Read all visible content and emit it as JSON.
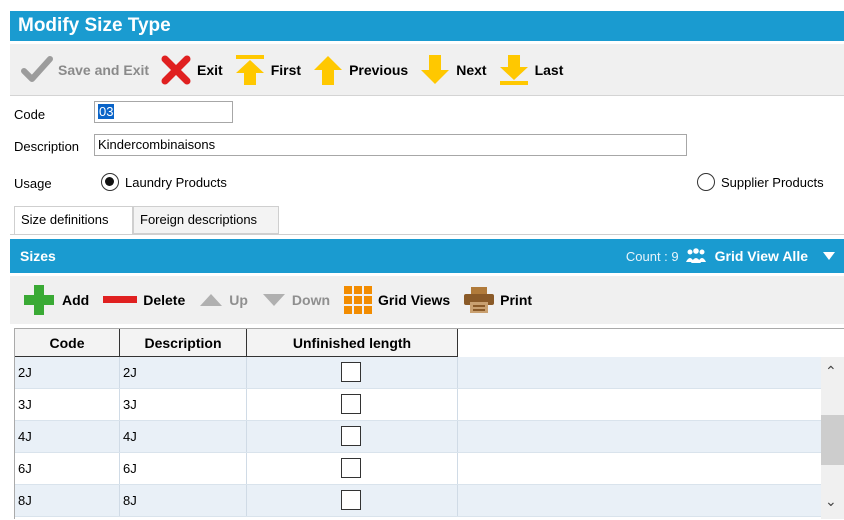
{
  "window": {
    "title": "Modify Size Type"
  },
  "toolbar": {
    "save_exit": "Save and Exit",
    "exit": "Exit",
    "first": "First",
    "previous": "Previous",
    "next": "Next",
    "last": "Last"
  },
  "form": {
    "code_label": "Code",
    "code_value": "03",
    "description_label": "Description",
    "description_value": "Kindercombinaisons",
    "usage_label": "Usage",
    "usage_options": [
      {
        "label": "Laundry Products",
        "selected": true
      },
      {
        "label": "Supplier Products",
        "selected": false
      }
    ]
  },
  "tabs": [
    {
      "label": "Size definitions",
      "active": true
    },
    {
      "label": "Foreign descriptions",
      "active": false
    }
  ],
  "sizes": {
    "title": "Sizes",
    "count_text": "Count : 9",
    "grid_view": "Grid View Alle"
  },
  "subtoolbar": {
    "add": "Add",
    "delete": "Delete",
    "up": "Up",
    "down": "Down",
    "grid_views": "Grid Views",
    "print": "Print"
  },
  "grid": {
    "columns": [
      "Code",
      "Description",
      "Unfinished length"
    ],
    "rows": [
      {
        "code": "2J",
        "description": "2J",
        "unfinished": false
      },
      {
        "code": "3J",
        "description": "3J",
        "unfinished": false
      },
      {
        "code": "4J",
        "description": "4J",
        "unfinished": false
      },
      {
        "code": "6J",
        "description": "6J",
        "unfinished": false
      },
      {
        "code": "8J",
        "description": "8J",
        "unfinished": false
      }
    ]
  },
  "colors": {
    "accent": "#1a9bd0",
    "arrow_yellow": "#ffc800",
    "exit_red": "#e02020",
    "add_green": "#3aaa35",
    "grid_orange": "#f28c00"
  }
}
